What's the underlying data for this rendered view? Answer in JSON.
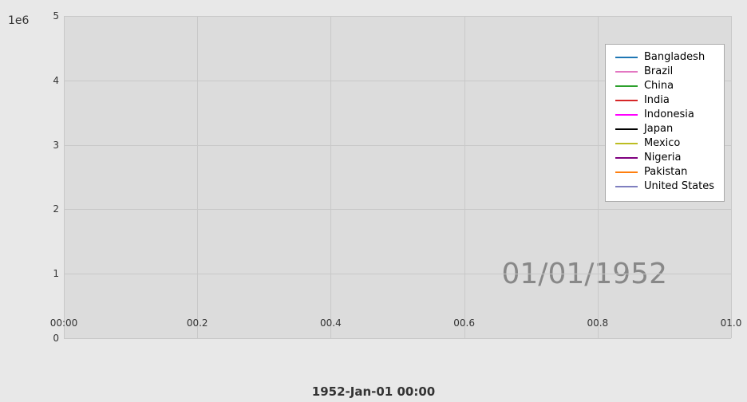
{
  "chart": {
    "title": "",
    "y_axis_multiplier": "1e6",
    "y_ticks": [
      "0",
      "1",
      "2",
      "3",
      "4",
      "5"
    ],
    "x_ticks": [
      "00:00",
      "00.2",
      "00.4",
      "00.6",
      "00.8",
      "01.0"
    ],
    "x_label": "1952-Jan-01 00:00",
    "date_overlay": "01/01/1952",
    "grid_lines_h": 6,
    "grid_lines_v": 6
  },
  "legend": {
    "items": [
      {
        "label": "Bangladesh",
        "color": "#1f77b4"
      },
      {
        "label": "Brazil",
        "color": "#e377c2"
      },
      {
        "label": "China",
        "color": "#2ca02c"
      },
      {
        "label": "India",
        "color": "#d62728"
      },
      {
        "label": "Indonesia",
        "color": "#ff00ff"
      },
      {
        "label": "Japan",
        "color": "#000000"
      },
      {
        "label": "Mexico",
        "color": "#bcbd22"
      },
      {
        "label": "Nigeria",
        "color": "#7f007f"
      },
      {
        "label": "Pakistan",
        "color": "#ff7f0e"
      },
      {
        "label": "United States",
        "color": "#7f7fbf"
      }
    ]
  }
}
